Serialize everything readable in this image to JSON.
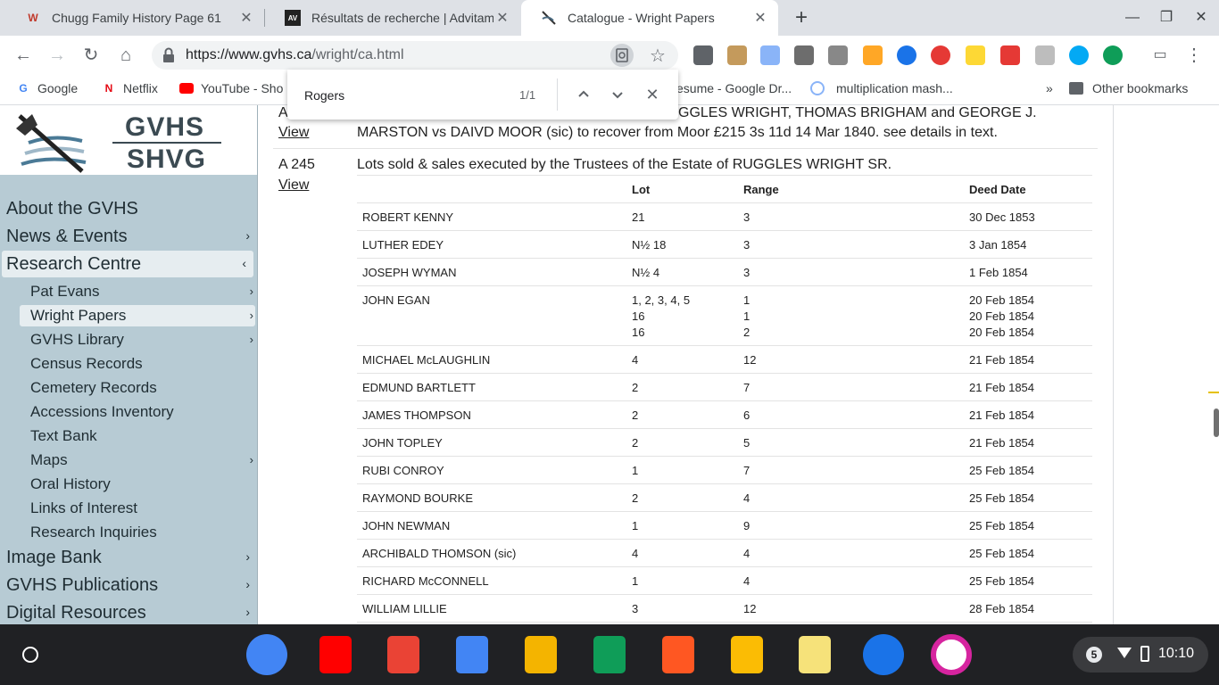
{
  "tabs": [
    {
      "title": "Chugg Family History Page 61",
      "favicon": "W",
      "favicon_color": "#c0392b"
    },
    {
      "title": "Résultats de recherche | Advitam",
      "favicon": "AV",
      "favicon_color": "#222222"
    },
    {
      "title": "Catalogue - Wright Papers",
      "favicon": "GV",
      "favicon_color": "#4a6a80"
    }
  ],
  "toolbar": {
    "url_host": "https://www.gvhs.ca",
    "url_path": "/wright/ca.html"
  },
  "bookmarks": [
    {
      "label": "Google",
      "icon": "google-icon",
      "color": "#4285f4"
    },
    {
      "label": "Netflix",
      "icon": "netflix-icon",
      "color": "#e50914"
    },
    {
      "label": "YouTube - Sho",
      "icon": "youtube-icon",
      "color": "#ff0000"
    },
    {
      "label": "esume - Google Dr...",
      "icon": "drive-icon",
      "color": "#4285f4"
    },
    {
      "label": "multiplication mash...",
      "icon": "globe-icon",
      "color": "#1a73e8"
    }
  ],
  "bookmarks_more": "»",
  "other_bookmarks": "Other bookmarks",
  "find": {
    "query": "Rogers",
    "count": "1/1"
  },
  "sidebar": {
    "logo_top": "GVHS",
    "logo_bottom": "SHVG",
    "items": [
      {
        "label": "About the GVHS",
        "chevron": ""
      },
      {
        "label": "News & Events",
        "chevron": "›"
      },
      {
        "label": "Research Centre",
        "chevron": "‹"
      }
    ],
    "subitems": [
      {
        "label": "Pat Evans",
        "chevron": "›"
      },
      {
        "label": "Wright Papers",
        "chevron": "›"
      },
      {
        "label": "GVHS Library",
        "chevron": "›"
      },
      {
        "label": "Census Records",
        "chevron": ""
      },
      {
        "label": "Cemetery Records",
        "chevron": ""
      },
      {
        "label": "Accessions Inventory",
        "chevron": ""
      },
      {
        "label": "Text Bank",
        "chevron": ""
      },
      {
        "label": "Maps",
        "chevron": "›"
      },
      {
        "label": "Oral History",
        "chevron": ""
      },
      {
        "label": "Links of Interest",
        "chevron": ""
      },
      {
        "label": "Research Inquiries",
        "chevron": ""
      }
    ],
    "items_bottom": [
      {
        "label": "Image Bank",
        "chevron": "›"
      },
      {
        "label": "GVHS Publications",
        "chevron": "›"
      },
      {
        "label": "Digital Resources",
        "chevron": "›"
      }
    ]
  },
  "entries": {
    "prev": {
      "ref": "A",
      "view": "View",
      "line1": "GGLES WRIGHT, THOMAS BRIGHAM and GEORGE J.",
      "line2": "MARSTON vs DAIVD MOOR (sic) to recover from Moor £215 3s 11d 14 Mar 1840. see details in text."
    },
    "current": {
      "ref": "A 245",
      "view": "View",
      "description": "Lots sold & sales executed by the Trustees of the Estate of RUGGLES WRIGHT SR."
    }
  },
  "table": {
    "headers": {
      "name": "",
      "lot": "Lot",
      "range": "Range",
      "date": "Deed Date"
    },
    "rows": [
      {
        "name": "ROBERT KENNY",
        "lot": "21",
        "range": "3",
        "date": "30 Dec 1853"
      },
      {
        "name": "LUTHER EDEY",
        "lot": "N½ 18",
        "range": "3",
        "date": "3 Jan 1854"
      },
      {
        "name": "JOSEPH WYMAN",
        "lot": "N½ 4",
        "range": "3",
        "date": "1 Feb 1854"
      },
      {
        "name": "JOHN EGAN",
        "lot": "1, 2, 3, 4, 5\n16\n16",
        "range": "1\n1\n2",
        "date": "20 Feb 1854\n20 Feb 1854\n20 Feb 1854"
      },
      {
        "name": "MICHAEL McLAUGHLIN",
        "lot": "4",
        "range": "12",
        "date": "21 Feb 1854"
      },
      {
        "name": "EDMUND BARTLETT",
        "lot": "2",
        "range": "7",
        "date": "21 Feb 1854"
      },
      {
        "name": "JAMES THOMPSON",
        "lot": "2",
        "range": "6",
        "date": "21 Feb 1854"
      },
      {
        "name": "JOHN TOPLEY",
        "lot": "2",
        "range": "5",
        "date": "21 Feb 1854"
      },
      {
        "name": "RUBI CONROY",
        "lot": "1",
        "range": "7",
        "date": "25 Feb 1854"
      },
      {
        "name": "RAYMOND BOURKE",
        "lot": "2",
        "range": "4",
        "date": "25 Feb 1854"
      },
      {
        "name": "JOHN NEWMAN",
        "lot": "1",
        "range": "9",
        "date": "25 Feb 1854"
      },
      {
        "name": "ARCHIBALD THOMSON (sic)",
        "lot": "4",
        "range": "4",
        "date": "25 Feb 1854"
      },
      {
        "name": "RICHARD McCONNELL",
        "lot": "1",
        "range": "4",
        "date": "25 Feb 1854"
      },
      {
        "name": "WILLIAM LILLIE",
        "lot": "3",
        "range": "12",
        "date": "28 Feb 1854"
      }
    ]
  },
  "shelf": {
    "apps": [
      {
        "name": "chrome-app",
        "color": "#4285f4"
      },
      {
        "name": "youtube-app",
        "color": "#ff0000"
      },
      {
        "name": "gmail-app",
        "color": "#ea4335"
      },
      {
        "name": "docs-app",
        "color": "#4285f4"
      },
      {
        "name": "slides-app",
        "color": "#f4b400"
      },
      {
        "name": "sheets-app",
        "color": "#0f9d58"
      },
      {
        "name": "play-music-app",
        "color": "#ff5722"
      },
      {
        "name": "keep-app",
        "color": "#fbbc04"
      },
      {
        "name": "notes-app",
        "color": "#f6e27a"
      },
      {
        "name": "files-app",
        "color": "#1a73e8"
      },
      {
        "name": "instagram-app",
        "color": "#d6249f"
      }
    ],
    "notification_count": "5",
    "clock": "10:10"
  },
  "colors": {
    "sidebar_bg": "#b7cbd4",
    "sidebar_active": "#e6edf0",
    "find_highlight": "#e5c100"
  }
}
